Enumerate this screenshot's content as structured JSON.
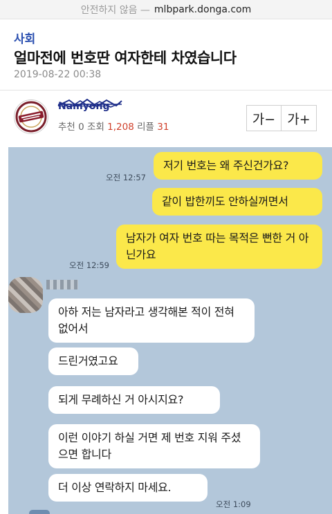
{
  "browser": {
    "security_label": "안전하지 않음 —",
    "domain": "mlbpark.donga.com"
  },
  "post": {
    "section": "사회",
    "title": "얼마전에 번호딴 여자한테 차였습니다",
    "date": "2019-08-22 00:38",
    "author": "Namyong",
    "stats": {
      "recommend_label": "추천",
      "recommend_count": "0",
      "views_label": "조회",
      "views_count": "1,208",
      "replies_label": "리플",
      "replies_count": "31"
    },
    "font_buttons": {
      "decrease": "가−",
      "increase": "가+"
    }
  },
  "chat": {
    "messages": [
      {
        "sender": "me",
        "text": "저기 번호는 왜 주신건가요?"
      },
      {
        "sender": "me",
        "text": "같이 밥한끼도 안하실꺼면서"
      },
      {
        "sender": "me",
        "text": "남자가 여자 번호 따는 목적은 뻔한 거 아닌가요"
      },
      {
        "sender": "them",
        "text": "아하 저는 남자라고 생각해본 적이 전혀 없어서"
      },
      {
        "sender": "them",
        "text": "드린거였고요"
      },
      {
        "sender": "them",
        "text": "되게 무례하신 거 아시지요?"
      },
      {
        "sender": "them",
        "text": "이런 이야기 하실 거면 제 번호 지워 주셨으면 합니다"
      },
      {
        "sender": "them",
        "text": "더 이상 연락하지 마세요."
      }
    ],
    "times": [
      "오전 12:57",
      "오전 12:59",
      "오전 1:09"
    ]
  },
  "colors": {
    "chat_background": "#b3c7da",
    "my_bubble": "#fbe84a",
    "their_bubble": "#ffffff",
    "section_link": "#2a4fb0",
    "stat_number": "#d0402b"
  }
}
